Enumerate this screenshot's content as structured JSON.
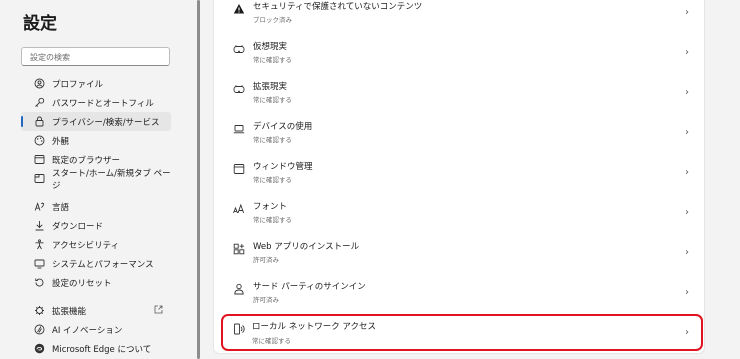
{
  "sidebar": {
    "title": "設定",
    "search_placeholder": "設定の検索",
    "items": [
      {
        "label": "プロファイル",
        "icon": "profile-icon"
      },
      {
        "label": "パスワードとオートフィル",
        "icon": "key-icon"
      },
      {
        "label": "プライバシー/検索/サービス",
        "icon": "lock-icon",
        "active": true
      },
      {
        "label": "外観",
        "icon": "appearance-icon"
      },
      {
        "label": "既定のブラウザー",
        "icon": "browser-icon"
      },
      {
        "label": "スタート/ホーム/新規タブ ページ",
        "icon": "home-icon"
      },
      {
        "label": "言語",
        "icon": "language-icon"
      },
      {
        "label": "ダウンロード",
        "icon": "download-icon"
      },
      {
        "label": "アクセシビリティ",
        "icon": "accessibility-icon"
      },
      {
        "label": "システムとパフォーマンス",
        "icon": "system-icon"
      },
      {
        "label": "設定のリセット",
        "icon": "reset-icon"
      },
      {
        "label": "拡張機能",
        "icon": "extensions-icon",
        "external": true
      },
      {
        "label": "AI イノベーション",
        "icon": "ai-icon"
      },
      {
        "label": "Microsoft Edge について",
        "icon": "edge-icon"
      }
    ]
  },
  "permissions": [
    {
      "title": "セキュリティで保護されていないコンテンツ",
      "status": "ブロック済み",
      "icon": "warning-icon"
    },
    {
      "title": "仮想現実",
      "status": "常に確認する",
      "icon": "vr-headset-icon"
    },
    {
      "title": "拡張現実",
      "status": "常に確認する",
      "icon": "ar-headset-icon"
    },
    {
      "title": "デバイスの使用",
      "status": "常に確認する",
      "icon": "laptop-icon"
    },
    {
      "title": "ウィンドウ管理",
      "status": "常に確認する",
      "icon": "window-icon"
    },
    {
      "title": "フォント",
      "status": "常に確認する",
      "icon": "font-icon"
    },
    {
      "title": "Web アプリのインストール",
      "status": "許可済み",
      "icon": "apps-icon"
    },
    {
      "title": "サード パーティのサインイン",
      "status": "許可済み",
      "icon": "person-icon"
    },
    {
      "title": "ローカル ネットワーク アクセス",
      "status": "常に確認する",
      "icon": "network-device-icon",
      "highlighted": true
    }
  ],
  "chevron": "›",
  "colors": {
    "accent": "#2167c2",
    "highlight": "#e0141e"
  }
}
